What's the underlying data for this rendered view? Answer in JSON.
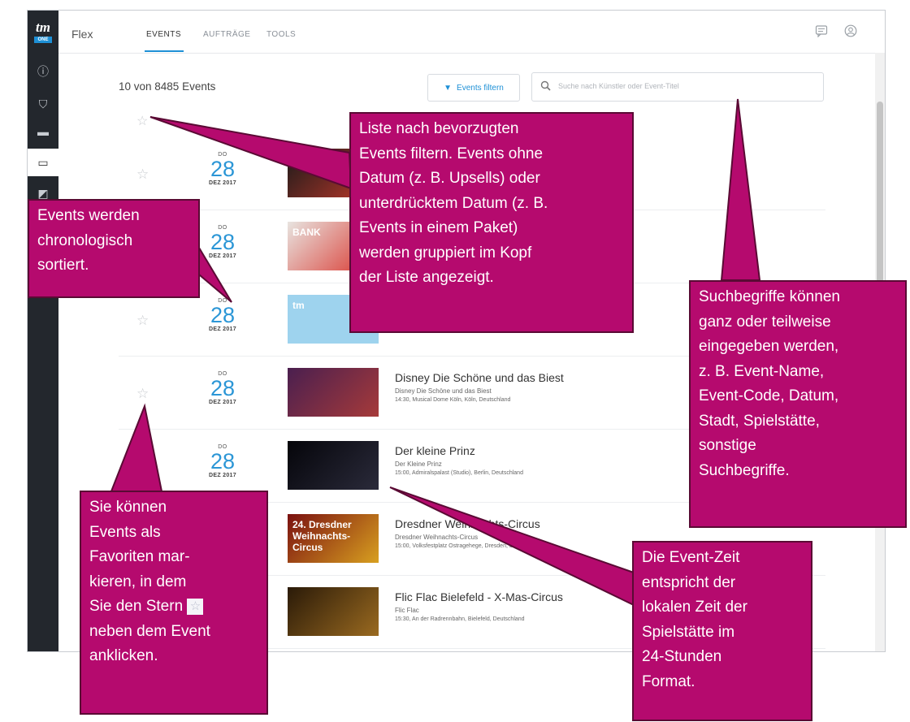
{
  "app": {
    "logo_text": "tm",
    "logo_badge": "ONE",
    "name": "Flex",
    "tabs": [
      {
        "label": "EVENTS",
        "active": true
      },
      {
        "label": "AUFTRÄGE",
        "active": false
      },
      {
        "label": "TOOLS",
        "active": false
      }
    ]
  },
  "sidebar": {
    "items": [
      {
        "icon": "info-icon",
        "glyph": "ⓘ"
      },
      {
        "icon": "user-lock-icon",
        "glyph": "⛉"
      },
      {
        "icon": "ticket-icon",
        "glyph": "▬"
      },
      {
        "icon": "calendar-icon",
        "glyph": "▭",
        "active": true
      },
      {
        "icon": "chart-icon",
        "glyph": "◩"
      }
    ]
  },
  "toolbar": {
    "count_text": "10 von 8485 Events",
    "filter_label": "Events filtern",
    "search_placeholder": "Suche nach Künstler oder Event-Titel"
  },
  "events": [
    {
      "dow": "DO",
      "day": "28",
      "month": "DEZ 2017",
      "name": "",
      "sub": "",
      "venue": "",
      "thumb_colors": [
        "#1a1a1a",
        "#c0392b"
      ]
    },
    {
      "dow": "DO",
      "day": "28",
      "month": "DEZ 2017",
      "name": "",
      "sub": "",
      "venue": "",
      "thumb_colors": [
        "#e8e4e0",
        "#d9332b"
      ],
      "thumb_text": "BANK"
    },
    {
      "dow": "DO",
      "day": "28",
      "month": "DEZ 2017",
      "name": "",
      "sub": "",
      "venue": "",
      "thumb_colors": [
        "#9ed3ee",
        "#9ed3ee"
      ],
      "thumb_text": "tm"
    },
    {
      "dow": "DO",
      "day": "28",
      "month": "DEZ 2017",
      "name": "Disney Die Schöne und das Biest",
      "sub": "Disney Die Schöne und das Biest",
      "venue": "14:30, Musical Dome Köln, Köln, Deutschland",
      "thumb_colors": [
        "#4a1f4f",
        "#a63a3a"
      ]
    },
    {
      "dow": "DO",
      "day": "28",
      "month": "DEZ 2017",
      "name": "Der kleine Prinz",
      "sub": "Der Kleine Prinz",
      "venue": "15:00, Admiralspalast (Studio), Berlin, Deutschland",
      "thumb_colors": [
        "#05050a",
        "#2a2a3a"
      ]
    },
    {
      "dow": "DO",
      "day": "28",
      "month": "DEZ 2017",
      "name": "Dresdner Weihnachts-Circus",
      "sub": "Dresdner Weihnachts-Circus",
      "venue": "15:00, Volksfestplatz Ostragehege, Dresden, Deutschland",
      "thumb_colors": [
        "#7a1010",
        "#d8a020"
      ],
      "thumb_text": "24. Dresdner Weihnachts-Circus"
    },
    {
      "dow": "DO",
      "day": "28",
      "month": "DEZ 2017",
      "name": "Flic Flac Bielefeld - X-Mas-Circus",
      "sub": "Flic Flac",
      "venue": "15:30, An der Radrennbahn, Bielefeld, Deutschland",
      "thumb_colors": [
        "#2a1a08",
        "#9a6a20"
      ]
    }
  ],
  "callouts": [
    {
      "lines": [
        "Liste nach bevorzugten",
        "Events filtern. Events ohne",
        "Datum (z. B. Upsells) oder",
        "unterdrücktem Datum (z. B.",
        "Events in einem Paket)",
        "werden gruppiert im Kopf",
        "der Liste angezeigt."
      ]
    },
    {
      "lines": [
        "Events werden",
        "chronologisch",
        "sortiert."
      ]
    },
    {
      "lines": [
        "Suchbegriffe können",
        "ganz oder teilweise",
        "eingegeben werden,",
        "z. B. Event-Name,",
        "Event-Code, Datum,",
        "Stadt, Spielstätte,",
        "sonstige",
        "Suchbegriffe."
      ]
    },
    {
      "lines": [
        "Sie können",
        "Events als",
        "Favoriten mar-",
        "kieren, in dem",
        "Sie den Stern",
        "neben dem Event",
        "anklicken."
      ]
    },
    {
      "lines": [
        "Die Event-Zeit",
        "entspricht der",
        "lokalen Zeit der",
        "Spielstätte im",
        "24-Stunden",
        "Format."
      ]
    }
  ],
  "colors": {
    "callout_fill": "#b50a6e",
    "callout_border": "#5a0a34",
    "accent": "#1e90d6"
  }
}
